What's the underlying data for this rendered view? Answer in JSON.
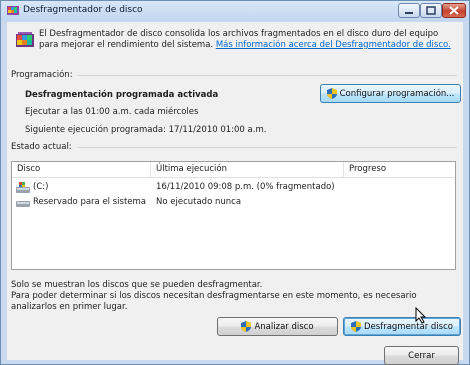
{
  "window": {
    "title": "Desfragmentador de disco",
    "description": "El Desfragmentador de disco consolida los archivos fragmentados en el disco duro del equipo para mejorar el rendimiento del sistema.",
    "more_info_link": "Más información acerca del Desfragmentador de disco."
  },
  "schedule": {
    "section_label": "Programación:",
    "status_title": "Desfragmentación programada activada",
    "run_text": "Ejecutar a las 01:00 a.m. cada miércoles",
    "next_run": "Siguiente ejecución programada: 17/11/2010 01:00 a.m.",
    "configure_button": "Configurar programación..."
  },
  "current_state": {
    "section_label": "Estado actual:",
    "columns": [
      "Disco",
      "Última ejecución",
      "Progreso"
    ],
    "rows": [
      {
        "disk": "(C:)",
        "last_run": "16/11/2010 09:08 p.m. (0% fragmentado)",
        "progress": "",
        "icon": "hard-drive-windows-icon"
      },
      {
        "disk": "Reservado para el sistema",
        "last_run": "No ejecutado nunca",
        "progress": "",
        "icon": "hard-drive-icon"
      }
    ]
  },
  "footer": {
    "note1": "Solo se muestran los discos que se pueden desfragmentar.",
    "note2": "Para poder determinar si los discos necesitan desfragmentarse en este momento, es necesario analizarlos en primer lugar.",
    "analyze_button": "Analizar disco",
    "defrag_button": "Desfragmentar disco",
    "close_button": "Cerrar"
  },
  "colors": {
    "link": "#0066cc",
    "title_bar": "#c9daef",
    "close_button": "#c3422e"
  }
}
